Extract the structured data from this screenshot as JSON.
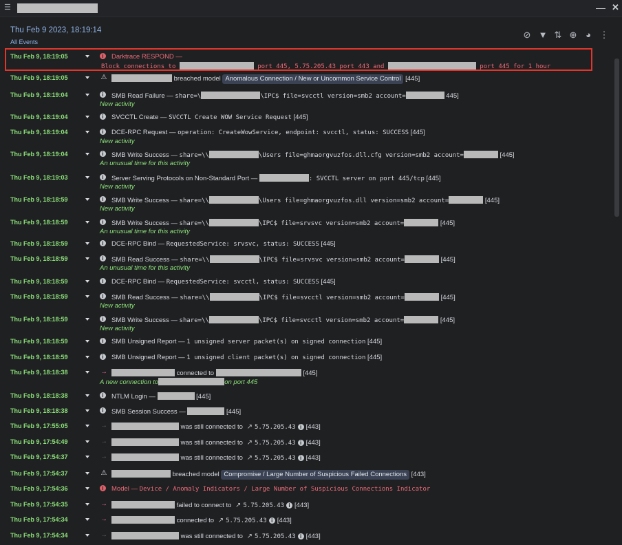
{
  "header": {
    "date": "Thu Feb 9 2023, 18:19:14",
    "subtitle": "All Events",
    "tools": [
      "filter-off-icon",
      "filter-icon",
      "filter-sort-icon",
      "filter-add-icon",
      "palette-icon",
      "more-icon"
    ]
  },
  "rows": [
    {
      "time": "Thu Feb 9, 18:19:05",
      "type": "respond",
      "icon": "info-red",
      "l1a": "Darktrace RESPOND —",
      "l2a": "Block connections to",
      "r1": 108,
      "l2b": "port 445, 5.75.205.43 port 443 and",
      "r2": 128,
      "l2c": "port 445 for 1 hour"
    },
    {
      "time": "Thu Feb 9, 18:19:05",
      "type": "breach",
      "icon": "warn",
      "r1": 88,
      "text": "breached model",
      "pill": "Anomalous Connection / New or Uncommon Service Control",
      "tail": "[445]"
    },
    {
      "time": "Thu Feb 9, 18:19:04",
      "type": "smb",
      "icon": "info",
      "label": "SMB Read Failure —",
      "m1": "share=\\",
      "r1": 86,
      "m2": "\\IPC$ file=svcctl version=smb2 account=",
      "r2": 56,
      "m3": "445]",
      "note": "New activity"
    },
    {
      "time": "Thu Feb 9, 18:19:04",
      "type": "plain",
      "icon": "info",
      "label": "SVCCTL Create —",
      "mono": "SVCCTL Create WOW Service Request",
      "tail": "[445]"
    },
    {
      "time": "Thu Feb 9, 18:19:04",
      "type": "plain",
      "icon": "info",
      "label": "DCE-RPC Request —",
      "mono": "operation: CreateWowService, endpoint: svcctl, status: SUCCESS",
      "tail": "[445]",
      "note": "New activity"
    },
    {
      "time": "Thu Feb 9, 18:19:04",
      "type": "smb",
      "icon": "info",
      "label": "SMB Write Success —",
      "m1": "share=\\\\",
      "r1": 72,
      "m2": "\\Users file=ghmaorgvuzfos.dll.cfg version=smb2 account=",
      "r2": 50,
      "m3": "[445]",
      "note": "An unusual time for this activity"
    },
    {
      "time": "Thu Feb 9, 18:19:03",
      "type": "server",
      "icon": "info",
      "label": "Server Serving Protocols on Non-Standard Port —",
      "r1": 72,
      "mono": ": SVCCTL server on port 445/tcp",
      "tail": "[445]",
      "note": "New activity"
    },
    {
      "time": "Thu Feb 9, 18:18:59",
      "type": "smb",
      "icon": "info",
      "label": "SMB Write Success —",
      "m1": "share=\\\\",
      "r1": 72,
      "m2": "\\Users file=ghmaorgvuzfos.dll version=smb2 account=",
      "r2": 50,
      "m3": "[445]",
      "note": "New activity"
    },
    {
      "time": "Thu Feb 9, 18:18:59",
      "type": "smb",
      "icon": "info",
      "label": "SMB Write Success —",
      "m1": "share=\\\\",
      "r1": 72,
      "m2": "\\IPC$ file=srvsvc version=smb2 account=",
      "r2": 50,
      "m3": "[445]",
      "note": "An unusual time for this activity"
    },
    {
      "time": "Thu Feb 9, 18:18:59",
      "type": "plain",
      "icon": "info",
      "label": "DCE-RPC Bind —",
      "mono": "RequestedService: srvsvc, status: SUCCESS",
      "tail": "[445]"
    },
    {
      "time": "Thu Feb 9, 18:18:59",
      "type": "smb",
      "icon": "info",
      "label": "SMB Read Success —",
      "m1": "share=\\\\",
      "r1": 72,
      "m2": "\\IPC$ file=srvsvc version=smb2 account=",
      "r2": 50,
      "m3": "[445]",
      "note": "An unusual time for this activity"
    },
    {
      "time": "Thu Feb 9, 18:18:59",
      "type": "plain",
      "icon": "info",
      "label": "DCE-RPC Bind —",
      "mono": "RequestedService: svcctl, status: SUCCESS",
      "tail": "[445]"
    },
    {
      "time": "Thu Feb 9, 18:18:59",
      "type": "smb",
      "icon": "info",
      "label": "SMB Read Success —",
      "m1": "share=\\\\",
      "r1": 72,
      "m2": "\\IPC$ file=svcctl version=smb2 account=",
      "r2": 50,
      "m3": "[445]",
      "note": "New activity"
    },
    {
      "time": "Thu Feb 9, 18:18:59",
      "type": "smb",
      "icon": "info",
      "label": "SMB Write Success —",
      "m1": "share=\\\\",
      "r1": 72,
      "m2": "\\IPC$ file=svcctl version=smb2 account=",
      "r2": 50,
      "m3": "[445]",
      "note": "New activity"
    },
    {
      "time": "Thu Feb 9, 18:18:59",
      "type": "plain",
      "icon": "info",
      "label": "SMB Unsigned Report —",
      "mono": "1 unsigned server packet(s) on signed connection",
      "tail": "[445]"
    },
    {
      "time": "Thu Feb 9, 18:18:59",
      "type": "plain",
      "icon": "info",
      "label": "SMB Unsigned Report —",
      "mono": "1 unsigned client packet(s) on signed connection",
      "tail": "[445]"
    },
    {
      "time": "Thu Feb 9, 18:18:38",
      "type": "conn",
      "icon": "arrow",
      "r1": 92,
      "text": "connected to",
      "r2": 124,
      "tail": "[445]",
      "note": "A new connection to",
      "r3": 96,
      "note2": "on port 445"
    },
    {
      "time": "Thu Feb 9, 18:18:38",
      "type": "labelr",
      "icon": "info",
      "label": "NTLM Login —",
      "r1": 54,
      "tail": "[445]"
    },
    {
      "time": "Thu Feb 9, 18:18:38",
      "type": "labelr",
      "icon": "info",
      "label": "SMB Session Success —",
      "r1": 54,
      "tail": "[445]"
    },
    {
      "time": "Thu Feb 9, 17:55:05",
      "type": "still",
      "icon": "arrow-dim",
      "r1": 98,
      "text": "was still connected to",
      "ip": "5.75.205.43",
      "tail": "[443]"
    },
    {
      "time": "Thu Feb 9, 17:54:49",
      "type": "still",
      "icon": "arrow-dim",
      "r1": 98,
      "text": "was still connected to",
      "ip": "5.75.205.43",
      "tail": "[443]"
    },
    {
      "time": "Thu Feb 9, 17:54:37",
      "type": "still",
      "icon": "arrow-dim",
      "r1": 98,
      "text": "was still connected to",
      "ip": "5.75.205.43",
      "tail": "[443]"
    },
    {
      "time": "Thu Feb 9, 17:54:37",
      "type": "breach",
      "icon": "warn",
      "r1": 86,
      "text": "breached model",
      "pill": "Compromise / Large Number of Suspicious Failed Connections",
      "tail": "[443]"
    },
    {
      "time": "Thu Feb 9, 17:54:36",
      "type": "model",
      "icon": "info-red",
      "label": "Model —",
      "mono": "Device / Anomaly Indicators / Large Number of Suspicious Connections Indicator"
    },
    {
      "time": "Thu Feb 9, 17:54:35",
      "type": "still",
      "icon": "arrow",
      "r1": 92,
      "text": "failed to connect to",
      "ip": "5.75.205.43",
      "tail": "[443]"
    },
    {
      "time": "Thu Feb 9, 17:54:34",
      "type": "still",
      "icon": "arrow",
      "r1": 92,
      "text": "connected to",
      "ip": "5.75.205.43",
      "tail": "[443]"
    },
    {
      "time": "Thu Feb 9, 17:54:34",
      "type": "still",
      "icon": "arrow-dim",
      "r1": 98,
      "text": "was still connected to",
      "ip": "5.75.205.43",
      "tail": "[443]"
    }
  ]
}
